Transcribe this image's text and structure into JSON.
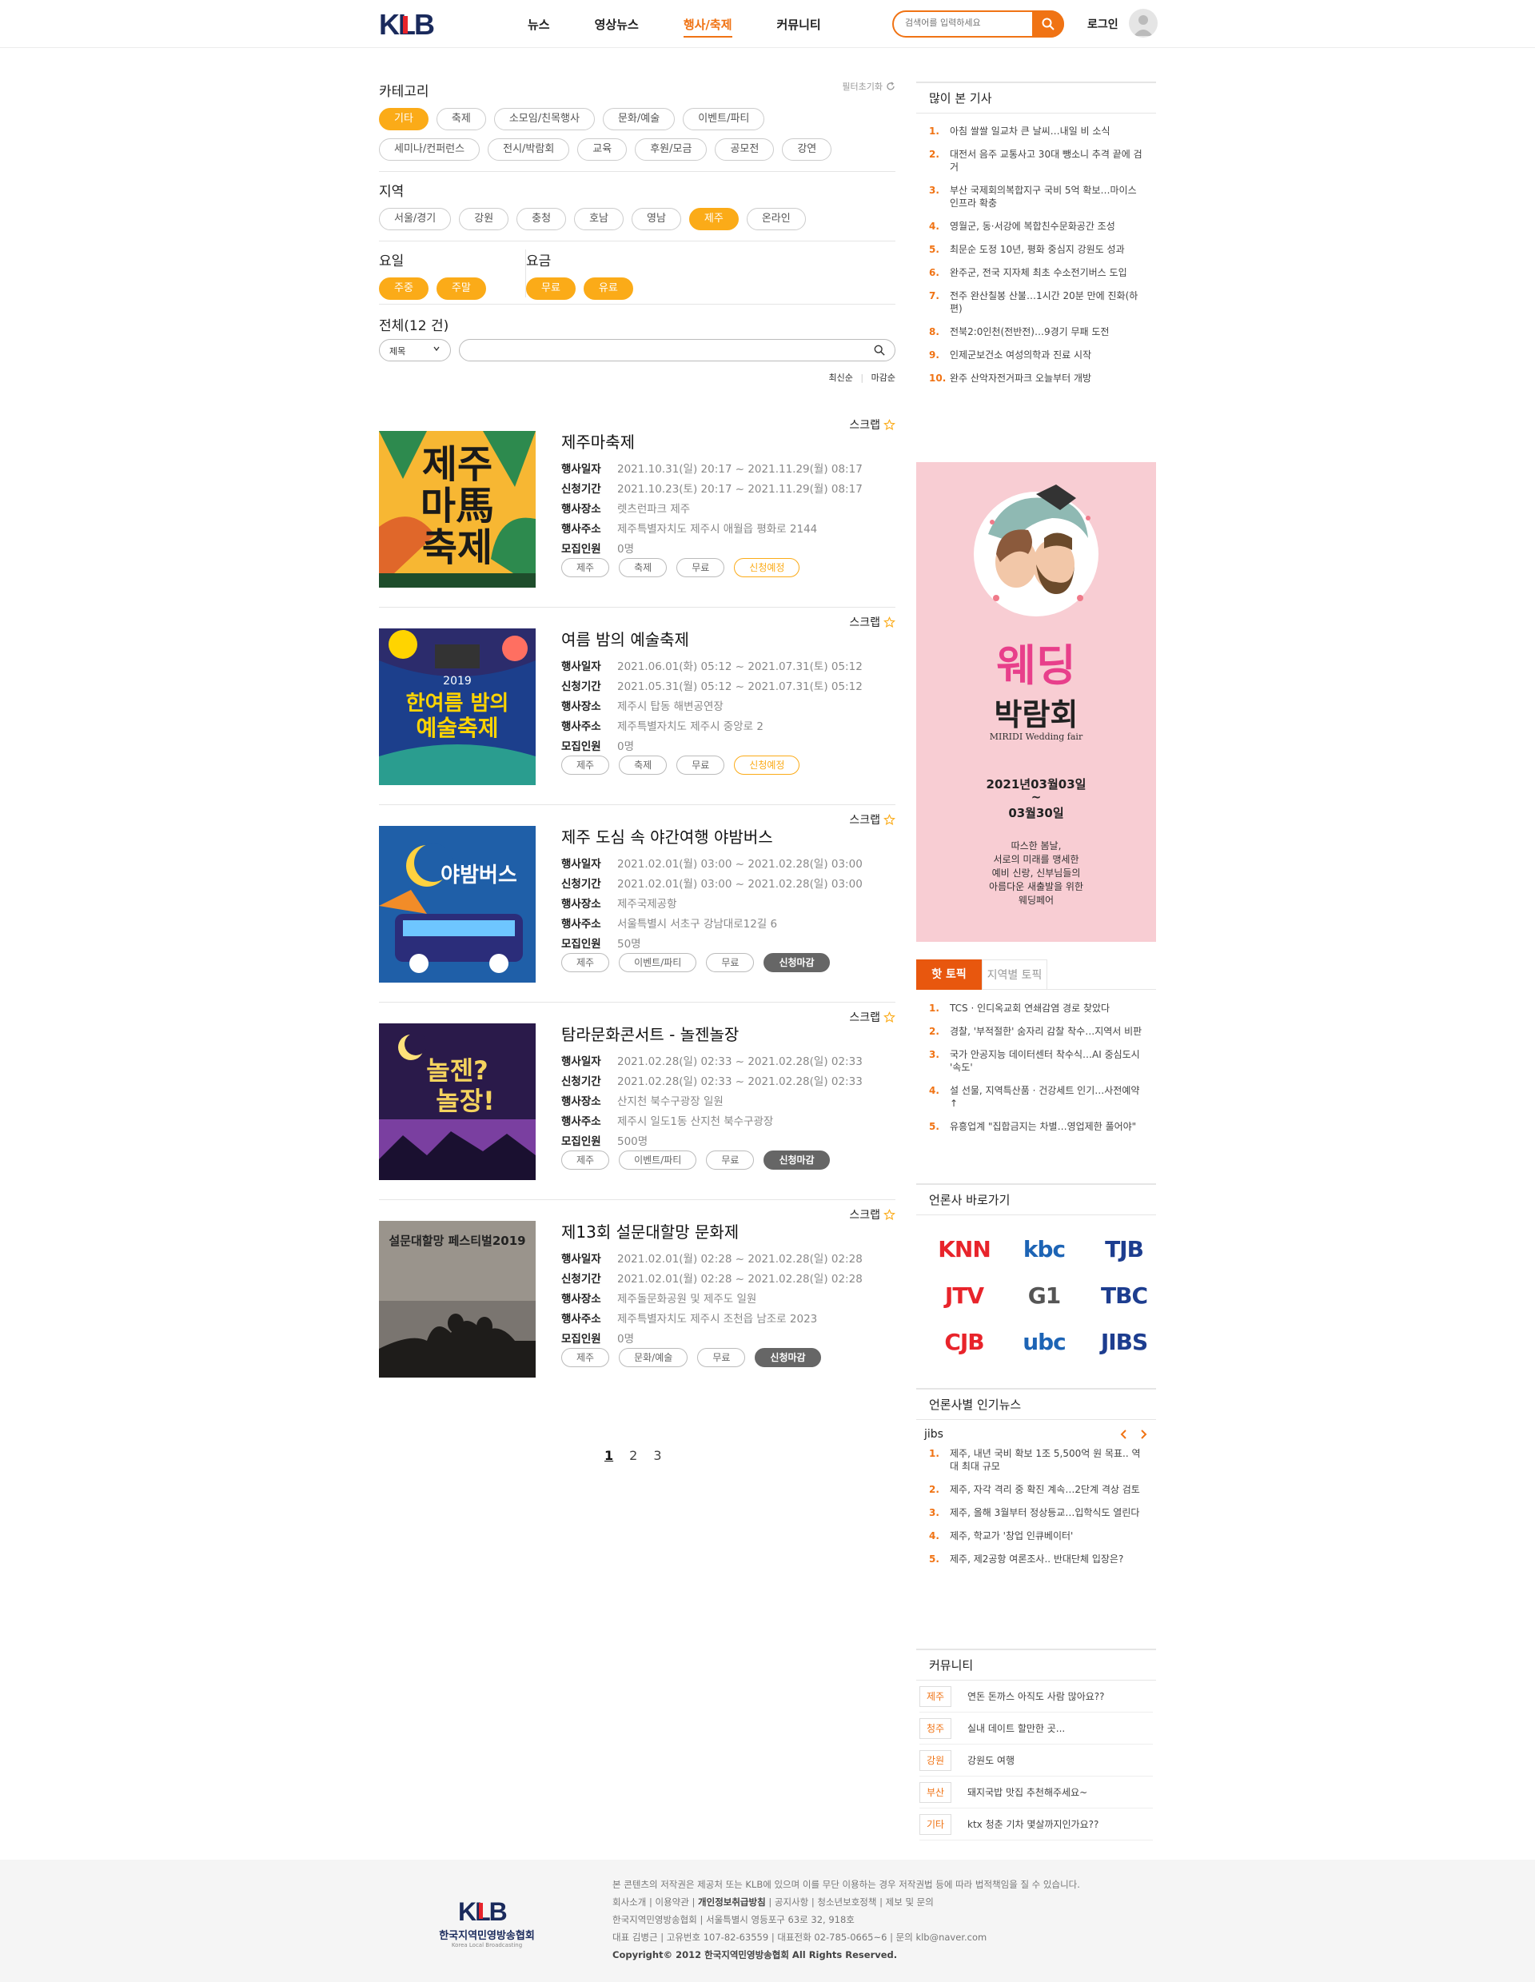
{
  "header": {
    "logo_text": "KLB",
    "nav": [
      "뉴스",
      "영상뉴스",
      "행사/축제",
      "커뮤니티"
    ],
    "active_nav": "행사/축제",
    "search_placeholder": "검색어를 입력하세요",
    "login_label": "로그인"
  },
  "filters": {
    "category_title": "카테고리",
    "reset_label": "필터초기화",
    "categories_row1": [
      "기타",
      "축제",
      "소모임/친목행사",
      "문화/예술",
      "이벤트/파티"
    ],
    "categories_row2": [
      "세미나/컨퍼런스",
      "전시/박람회",
      "교육",
      "후원/모금",
      "공모전",
      "강연"
    ],
    "active_category": "기타",
    "region_title": "지역",
    "regions": [
      "서울/경기",
      "강원",
      "충청",
      "호남",
      "영남",
      "제주",
      "온라인"
    ],
    "active_region": "제주",
    "day_title": "요일",
    "days": [
      "주중",
      "주말"
    ],
    "fee_title": "요금",
    "fees": [
      "무료",
      "유료"
    ]
  },
  "list": {
    "total_label": "전체(12 건)",
    "select_value": "제목",
    "sort_latest": "최신순",
    "sort_deadline": "마감순",
    "scrap_label": "스크랩",
    "field_labels": [
      "행사일자",
      "신청기간",
      "행사장소",
      "행사주소",
      "모집인원"
    ],
    "items": [
      {
        "title": "제주마축제",
        "date": "2021.10.31(일) 20:17 ~ 2021.11.29(월) 08:17",
        "apply": "2021.10.23(토) 20:17 ~ 2021.11.29(월) 08:17",
        "place": "렛츠런파크 제주",
        "address": "제주특별자치도 제주시 애월읍 평화로 2144",
        "people": "0명",
        "tags": [
          "제주",
          "축제",
          "무료"
        ],
        "status": "신청예정"
      },
      {
        "title": "여름 밤의 예술축제",
        "date": "2021.06.01(화) 05:12 ~ 2021.07.31(토) 05:12",
        "apply": "2021.05.31(월) 05:12 ~ 2021.07.31(토) 05:12",
        "place": "제주시 탑동 해변공연장",
        "address": "제주특별자치도 제주시 중앙로 2",
        "people": "0명",
        "tags": [
          "제주",
          "축제",
          "무료"
        ],
        "status": "신청예정"
      },
      {
        "title": "제주 도심 속 야간여행 야밤버스",
        "date": "2021.02.01(월) 03:00 ~ 2021.02.28(일) 03:00",
        "apply": "2021.02.01(월) 03:00 ~ 2021.02.28(일) 03:00",
        "place": "제주국제공항",
        "address": "서울특별시 서초구 강남대로12길 6",
        "people": "50명",
        "tags": [
          "제주",
          "이벤트/파티",
          "무료"
        ],
        "status": "신청마감"
      },
      {
        "title": "탐라문화콘서트 - 놀젠놀장",
        "date": "2021.02.28(일) 02:33 ~ 2021.02.28(일) 02:33",
        "apply": "2021.02.28(일) 02:33 ~ 2021.02.28(일) 02:33",
        "place": "산지천 북수구광장 일원",
        "address": "제주시 일도1동 산지천 북수구광장",
        "people": "500명",
        "tags": [
          "제주",
          "이벤트/파티",
          "무료"
        ],
        "status": "신청마감"
      },
      {
        "title": "제13회 설문대할망 문화제",
        "date": "2021.02.01(월) 02:28 ~ 2021.02.28(일) 02:28",
        "apply": "2021.02.01(월) 02:28 ~ 2021.02.28(일) 02:28",
        "place": "제주돌문화공원 및 제주도 일원",
        "address": "제주특별자치도 제주시 조천읍 남조로 2023",
        "people": "0명",
        "tags": [
          "제주",
          "문화/예술",
          "무료"
        ],
        "status": "신청마감"
      }
    ],
    "pages": [
      "1",
      "2",
      "3"
    ],
    "current_page": "1"
  },
  "posters": {
    "p1": [
      "제주",
      "마馬",
      "축제"
    ],
    "p2": [
      "2019",
      "한여름 밤의",
      "예술축제"
    ],
    "p3": "야밤버스",
    "p4": [
      "놀젠?",
      "놀장!"
    ],
    "p5": "설문대할망 페스티벌2019"
  },
  "sidebar": {
    "popular_title": "많이 본 기사",
    "popular": [
      "아침 쌀쌀 일교차 큰 날씨…내일 비 소식",
      "대전서 음주 교통사고 30대 뺑소니 추격 끝에 검거",
      "부산 국제회의복합지구 국비 5억 확보…마이스 인프라 확충",
      "영월군, 동·서강에 복합친수문화공간 조성",
      "최문순 도정 10년, 평화 중심지 강원도 성과",
      "완주군, 전국 지자체 최초 수소전기버스 도입",
      "전주 완산칠봉 산불…1시간 20분 만에 진화(하편)",
      "전북2:0인천(전반전)…9경기 무패 도전",
      "인제군보건소 여성의학과 진료 시작",
      "완주 산악자전거파크 오늘부터 개방"
    ],
    "ad": {
      "title1": "웨딩",
      "title2": "박람회",
      "sub": "MIRIDI Wedding fair",
      "date1": "2021년03월03일",
      "dash": "~",
      "date2": "03월30일",
      "desc": [
        "따스한 봄날,",
        "서로의 미래를 맹세한",
        "예비 신랑, 신부님들의",
        "아름다운 새출발을 위한",
        "웨딩페어"
      ]
    },
    "hot_tab1": "핫 토픽",
    "hot_tab2": "지역별 토픽",
    "hot": [
      "TCS · 인디옥교회 연쇄감염 경로 찾았다",
      "경찰, '부적절한' 숨자리 감찰 착수…지역서 비판",
      "국가 안공지능 데이터센터 착수식…AI 중심도시 '속도'",
      "설 선물, 지역특산품 · 건강세트 인기…사전예약↑",
      "유흥업계 \"집합금지는 차별…영업제한 풀어야\""
    ],
    "press_title": "언론사 바로가기",
    "press": [
      "KNN",
      "kbc",
      "TJB",
      "JTV",
      "G1",
      "TBC",
      "CJB",
      "ubc",
      "JIBS"
    ],
    "press_colors": [
      "#e8242b",
      "#1d64b5",
      "#1d3d8f",
      "#e8242b",
      "#555555",
      "#1d3d8f",
      "#e8242b",
      "#1d64b5",
      "#1d3d8f"
    ],
    "pop_title": "언론사별 인기뉴스",
    "pop_press": "jibs",
    "pop": [
      "제주, 내년 국비 확보 1조 5,500억 원 목표.. 역대 최대 규모",
      "제주, 자각 격리 중 확진 계속…2단계 격상 검토",
      "제주, 올해 3월부터 정상등교…입학식도 열린다",
      "제주, 학교가 '창업 인큐베이터'",
      "제주, 제2공항 여론조사.. 반대단체 입장은?"
    ],
    "comm_title": "커뮤니티",
    "comm": [
      {
        "region": "제주",
        "text": "연돈 돈까스 아직도 사람 많아요??"
      },
      {
        "region": "청주",
        "text": "실내 데이트 할만한 곳..."
      },
      {
        "region": "강원",
        "text": "강원도 여행"
      },
      {
        "region": "부산",
        "text": "돼지국밥 맛집 추천해주세요~"
      },
      {
        "region": "기타",
        "text": "ktx 청춘 기차 몇살까지인가요??"
      }
    ]
  },
  "footer": {
    "logo_text": "KLB",
    "org": "한국지역민영방송협회",
    "org_en": "Korea Local Broadcasting",
    "notice": "본 콘텐츠의 저작권은 제공처 또는 KLB에 있으며 이를 무단 이용하는 경우 저작권법 등에 따라 법적책임을 질 수 있습니다.",
    "links": [
      "회사소개",
      "이용약관",
      "개인정보취급방침",
      "공지사항",
      "청소년보호정책",
      "제보 및 문의"
    ],
    "addr": "한국지역민영방송협회 | 서울특별시 영등포구 63로 32, 918호",
    "info": "대표 김병근 | 고유번호 107-82-63559 | 대표전화 02-785-0665~6 | 문의 klb@naver.com",
    "copy": "Copyright© 2012 한국지역민영방송협회 All Rights Reserved."
  }
}
